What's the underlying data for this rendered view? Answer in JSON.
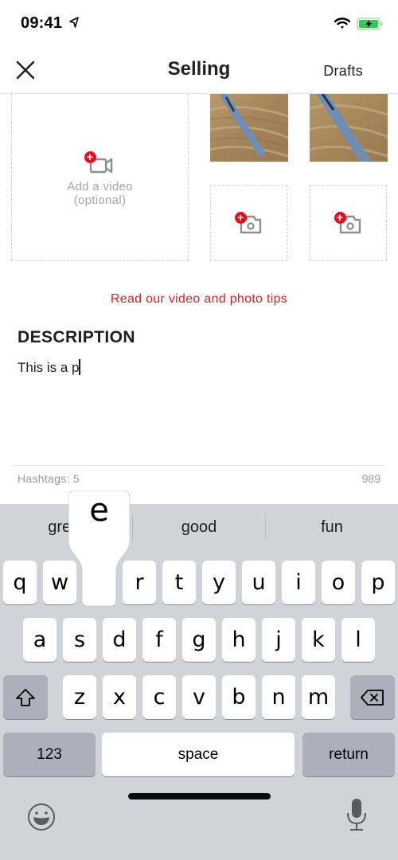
{
  "status_bar": {
    "time": "09:41",
    "icons": [
      "location-arrow-icon",
      "wifi-icon",
      "battery-charging-icon"
    ],
    "battery_color": "#34c759"
  },
  "nav": {
    "close_icon": "close-icon",
    "title": "Selling",
    "drafts_label": "Drafts"
  },
  "media": {
    "video_slot": {
      "icon": "add-video-icon",
      "label_line1": "Add a video",
      "label_line2": "(optional)"
    },
    "photos": [
      {
        "description": "Photo of a blue pen on a wooden table"
      },
      {
        "description": "Photo of a blue pen on a wooden table (closer)"
      }
    ],
    "empty_photo_slots": [
      {
        "icon": "add-photo-icon"
      },
      {
        "icon": "add-photo-icon"
      }
    ],
    "plus_symbol": "+",
    "accent_color": "#e0101c"
  },
  "tips_link": "Read our video and photo tips",
  "description": {
    "heading": "DESCRIPTION",
    "value": "This is a p",
    "hashtags_label": "Hashtags: 5",
    "remaining_chars": "989"
  },
  "keyboard": {
    "suggestions": [
      "great",
      "good",
      "fun"
    ],
    "suggestion_visible_partial": "gre",
    "pressed_key": "e",
    "row1": [
      "q",
      "w",
      "e",
      "r",
      "t",
      "y",
      "u",
      "i",
      "o",
      "p"
    ],
    "row2": [
      "a",
      "s",
      "d",
      "f",
      "g",
      "h",
      "j",
      "k",
      "l"
    ],
    "row3": [
      "z",
      "x",
      "c",
      "v",
      "b",
      "n",
      "m"
    ],
    "shift_icon": "shift-icon",
    "backspace_icon": "backspace-icon",
    "numbers_label": "123",
    "space_label": "space",
    "return_label": "return",
    "emoji_icon": "emoji-icon",
    "mic_icon": "microphone-icon"
  }
}
